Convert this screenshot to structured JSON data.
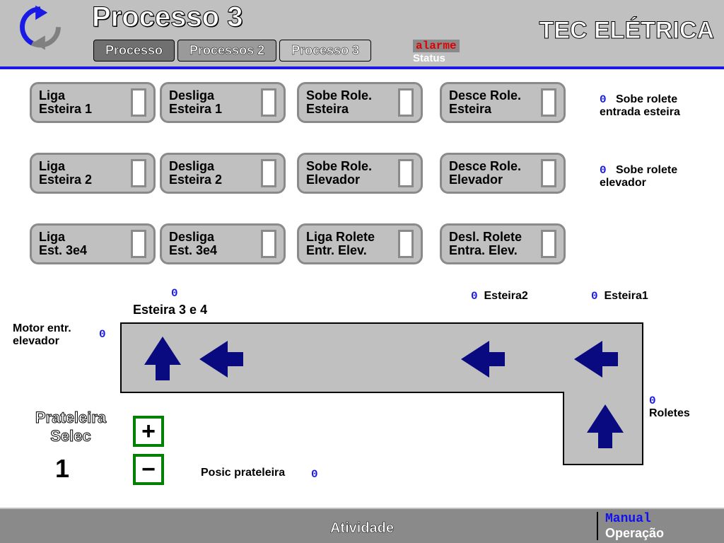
{
  "header": {
    "title": "Processo 3",
    "tabs": [
      "Processo",
      "Processos 2",
      "Processo 3"
    ],
    "alarm": "alarme",
    "status": "Status",
    "brand": "TEC ELÉTRICA"
  },
  "buttons": {
    "r1c1": "Liga\nEsteira 1",
    "r1c2": "Desliga\nEsteira 1",
    "r1c3": "Sobe Role.\nEsteira",
    "r1c4": "Desce Role.\nEsteira",
    "r2c1": "Liga\nEsteira 2",
    "r2c2": "Desliga\nEsteira 2",
    "r2c3": "Sobe Role.\nElevador",
    "r2c4": "Desce Role.\nElevador",
    "r3c1": "Liga\nEst. 3e4",
    "r3c2": "Desliga\nEst. 3e4",
    "r3c3": "Liga Rolete\nEntr. Elev.",
    "r3c4": "Desl. Rolete\nEntra. Elev."
  },
  "indicators": {
    "sobe_rolete_entrada_esteira": {
      "value": "0",
      "label": "Sobe rolete\nentrada esteira"
    },
    "sobe_rolete_elevador": {
      "value": "0",
      "label": "Sobe rolete\nelevador"
    },
    "esteira34": {
      "value": "0",
      "label": "Esteira 3 e 4"
    },
    "esteira2": {
      "value": "0",
      "label": "Esteira2"
    },
    "esteira1": {
      "value": "0",
      "label": "Esteira1"
    },
    "motor_entr_elevador": {
      "value": "0",
      "label": "Motor entr.\nelevador"
    },
    "roletes": {
      "value": "0",
      "label": "Roletes"
    },
    "posic_prateleira": {
      "value": "0",
      "label": "Posic prateleira"
    }
  },
  "prateleira": {
    "label": "Prateleira\nSelec",
    "value": "1"
  },
  "footer": {
    "activity": "Atividade",
    "mode1": "Manual",
    "mode2": "Operação"
  }
}
